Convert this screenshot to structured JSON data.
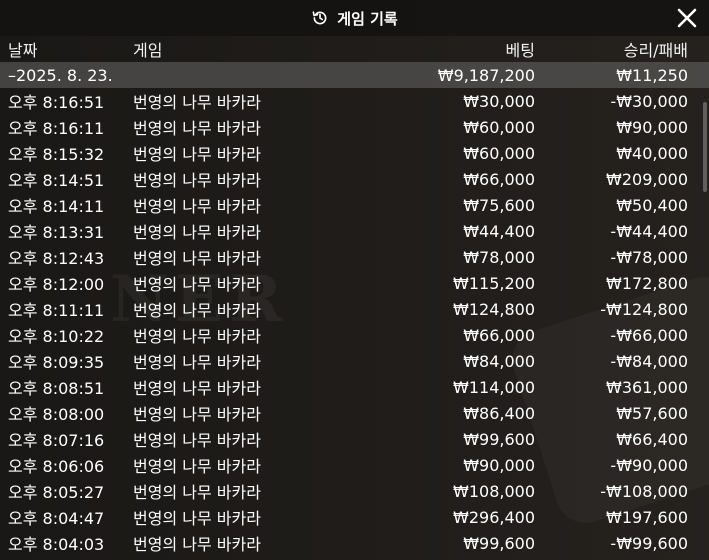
{
  "window": {
    "title": "게임 기록",
    "history_icon": "history-icon",
    "close_icon": "close-icon"
  },
  "columns": {
    "date": "날짜",
    "game": "게임",
    "bet": "베팅",
    "win_loss": "승리/패배"
  },
  "summary": {
    "date": "–2025. 8. 23.",
    "bet": "₩9,187,200",
    "win_loss": "₩11,250"
  },
  "rows": [
    {
      "time": "오후 8:16:51",
      "game": "번영의 나무 바카라",
      "bet": "₩30,000",
      "win_loss": "-₩30,000"
    },
    {
      "time": "오후 8:16:11",
      "game": "번영의 나무 바카라",
      "bet": "₩60,000",
      "win_loss": "₩90,000"
    },
    {
      "time": "오후 8:15:32",
      "game": "번영의 나무 바카라",
      "bet": "₩60,000",
      "win_loss": "₩40,000"
    },
    {
      "time": "오후 8:14:51",
      "game": "번영의 나무 바카라",
      "bet": "₩66,000",
      "win_loss": "₩209,000"
    },
    {
      "time": "오후 8:14:11",
      "game": "번영의 나무 바카라",
      "bet": "₩75,600",
      "win_loss": "₩50,400"
    },
    {
      "time": "오후 8:13:31",
      "game": "번영의 나무 바카라",
      "bet": "₩44,400",
      "win_loss": "-₩44,400"
    },
    {
      "time": "오후 8:12:43",
      "game": "번영의 나무 바카라",
      "bet": "₩78,000",
      "win_loss": "-₩78,000"
    },
    {
      "time": "오후 8:12:00",
      "game": "번영의 나무 바카라",
      "bet": "₩115,200",
      "win_loss": "₩172,800"
    },
    {
      "time": "오후 8:11:11",
      "game": "번영의 나무 바카라",
      "bet": "₩124,800",
      "win_loss": "-₩124,800"
    },
    {
      "time": "오후 8:10:22",
      "game": "번영의 나무 바카라",
      "bet": "₩66,000",
      "win_loss": "-₩66,000"
    },
    {
      "time": "오후 8:09:35",
      "game": "번영의 나무 바카라",
      "bet": "₩84,000",
      "win_loss": "-₩84,000"
    },
    {
      "time": "오후 8:08:51",
      "game": "번영의 나무 바카라",
      "bet": "₩114,000",
      "win_loss": "₩361,000"
    },
    {
      "time": "오후 8:08:00",
      "game": "번영의 나무 바카라",
      "bet": "₩86,400",
      "win_loss": "₩57,600"
    },
    {
      "time": "오후 8:07:16",
      "game": "번영의 나무 바카라",
      "bet": "₩99,600",
      "win_loss": "₩66,400"
    },
    {
      "time": "오후 8:06:06",
      "game": "번영의 나무 바카라",
      "bet": "₩90,000",
      "win_loss": "-₩90,000"
    },
    {
      "time": "오후 8:05:27",
      "game": "번영의 나무 바카라",
      "bet": "₩108,000",
      "win_loss": "-₩108,000"
    },
    {
      "time": "오후 8:04:47",
      "game": "번영의 나무 바카라",
      "bet": "₩296,400",
      "win_loss": "₩197,600"
    },
    {
      "time": "오후 8:04:03",
      "game": "번영의 나무 바카라",
      "bet": "₩99,600",
      "win_loss": "-₩99,600"
    }
  ]
}
